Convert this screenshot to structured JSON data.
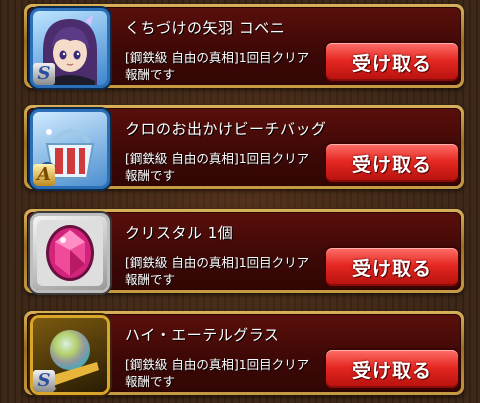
{
  "rewards": [
    {
      "name": "くちづけの矢羽 コベニ",
      "desc_line1": "[鋼鉄級 自由の真相]1回目クリア",
      "desc_line2": "報酬です",
      "button": "受け取る",
      "icon": "character-portrait-icon",
      "rank": "S",
      "frame_color": "#4aa0e0"
    },
    {
      "name": "クロのお出かけビーチバッグ",
      "desc_line1": "[鋼鉄級 自由の真相]1回目クリア",
      "desc_line2": "報酬です",
      "button": "受け取る",
      "icon": "beach-bag-icon",
      "rank": "A",
      "frame_color": "#4aa0e0"
    },
    {
      "name": "クリスタル 1個",
      "desc_line1": "[鋼鉄級 自由の真相]1回目クリア",
      "desc_line2": "報酬です",
      "button": "受け取る",
      "icon": "crystal-gem-icon",
      "frame_color": "#c9c9c9"
    },
    {
      "name": "ハイ・エーテルグラス",
      "desc_line1": "[鋼鉄級 自由の真相]1回目クリア",
      "desc_line2": "報酬です",
      "button": "受け取る",
      "icon": "ether-glass-icon",
      "rank": "S",
      "frame_color": "#e0b73a"
    }
  ]
}
